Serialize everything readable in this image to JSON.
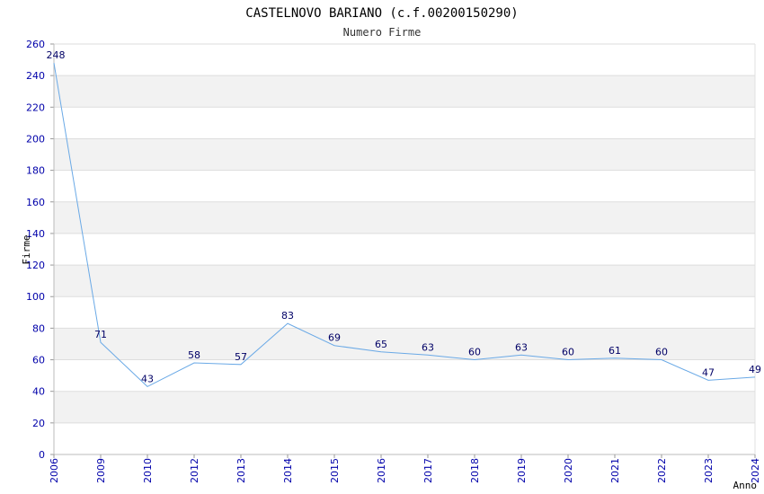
{
  "chart_data": {
    "type": "line",
    "title": "CASTELNOVO BARIANO (c.f.00200150290)",
    "subtitle": "Numero Firme",
    "xlabel": "Anno",
    "ylabel": "Firme",
    "categories": [
      "2006",
      "2009",
      "2010",
      "2012",
      "2013",
      "2014",
      "2015",
      "2016",
      "2017",
      "2018",
      "2019",
      "2020",
      "2021",
      "2022",
      "2023",
      "2024"
    ],
    "series": [
      {
        "values": [
          248,
          71,
          43,
          58,
          57,
          83,
          69,
          65,
          63,
          60,
          63,
          60,
          61,
          60,
          47,
          49
        ]
      }
    ],
    "ylim": [
      0,
      260
    ],
    "yticks": [
      0,
      20,
      40,
      60,
      80,
      100,
      120,
      140,
      160,
      180,
      200,
      220,
      240,
      260
    ],
    "grid": true,
    "colors": {
      "line": "#6aa9e6",
      "band": "#f2f2f2",
      "tick_text": "#0000aa",
      "label_text": "#000066"
    }
  }
}
